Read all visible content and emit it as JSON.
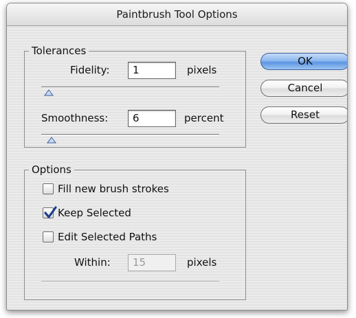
{
  "dialog": {
    "title": "Paintbrush Tool Options"
  },
  "tolerances": {
    "group_label": "Tolerances",
    "fidelity": {
      "label": "Fidelity:",
      "value": "1",
      "unit": "pixels"
    },
    "smoothness": {
      "label": "Smoothness:",
      "value": "6",
      "unit": "percent"
    }
  },
  "options": {
    "group_label": "Options",
    "fill_new_brush_strokes": {
      "label": "Fill new brush strokes",
      "checked": false
    },
    "keep_selected": {
      "label": "Keep Selected",
      "checked": true
    },
    "edit_selected_paths": {
      "label": "Edit Selected Paths",
      "checked": false
    },
    "within": {
      "label": "Within:",
      "value": "15",
      "unit": "pixels",
      "disabled": true
    }
  },
  "buttons": {
    "ok": "OK",
    "cancel": "Cancel",
    "reset": "Reset"
  },
  "colors": {
    "default_button": "#6a9fe6",
    "checkmark": "#1d3f8a"
  }
}
